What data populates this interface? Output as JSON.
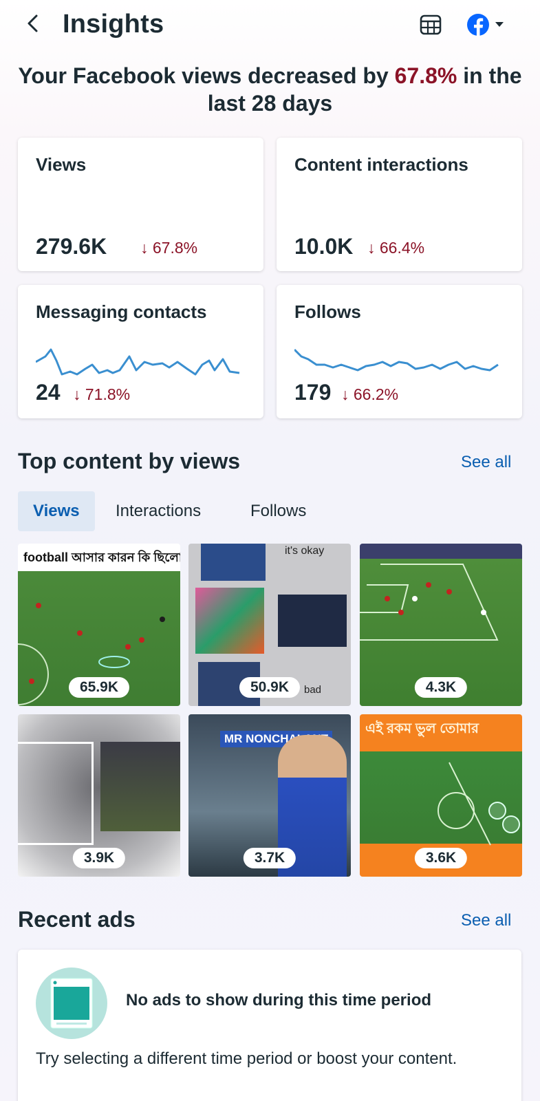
{
  "header": {
    "title": "Insights",
    "icons": [
      "back-arrow-icon",
      "table-icon",
      "facebook-icon",
      "caret-down-icon"
    ]
  },
  "headline": {
    "prefix": "Your Facebook views decreased by",
    "percent": "67.8%",
    "suffix": "in the last 28 days"
  },
  "metrics": [
    {
      "label": "Views",
      "value": "279.6K",
      "delta": "↓ 67.8%"
    },
    {
      "label": "Content interactions",
      "value": "10.0K",
      "delta": "↓ 66.4%"
    },
    {
      "label": "Messaging contacts",
      "value": "24",
      "delta": "↓ 71.8%"
    },
    {
      "label": "Follows",
      "value": "179",
      "delta": "↓ 66.2%"
    }
  ],
  "top_content": {
    "title": "Top content by views",
    "see_all": "See all",
    "tabs": [
      "Views",
      "Interactions",
      "Follows"
    ],
    "active_tab": "Views",
    "items": [
      {
        "views": "65.9K",
        "overlay_text": "football আসার কারন কি ছিলো"
      },
      {
        "views": "50.9K",
        "overlay_text": "it's okay",
        "overlay_text2": "bad"
      },
      {
        "views": "4.3K"
      },
      {
        "views": "3.9K"
      },
      {
        "views": "3.7K",
        "overlay_text": "MR NONCHALANT"
      },
      {
        "views": "3.6K",
        "overlay_text": "এই রকম ভুল তোমার"
      }
    ]
  },
  "recent_ads": {
    "title": "Recent ads",
    "see_all": "See all",
    "empty_title": "No ads to show during this time period",
    "empty_body": "Try selecting a different time period or boost your content."
  },
  "colors": {
    "negative": "#8b1327",
    "link": "#0a5eb0",
    "sparkline": "#3a8fd0",
    "active_tab_bg": "#dfe8f4"
  }
}
